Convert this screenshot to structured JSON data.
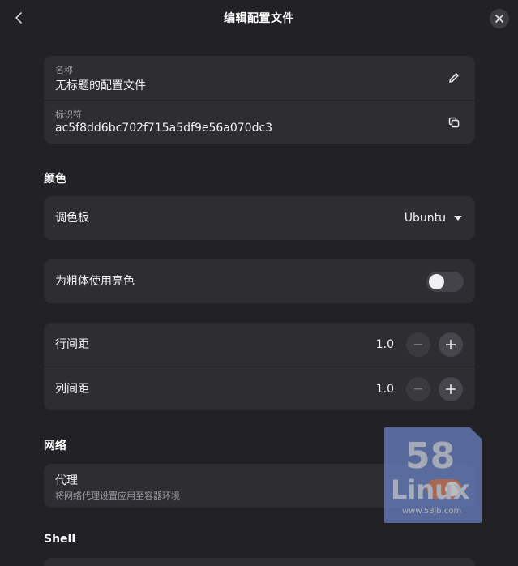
{
  "header": {
    "title": "编辑配置文件"
  },
  "profile": {
    "name_label": "名称",
    "name_value": "无标题的配置文件",
    "id_label": "标识符",
    "id_value": "ac5f8dd6bc702f715a5df9e56a070dc3"
  },
  "colors": {
    "section_title": "颜色",
    "palette_label": "调色板",
    "palette_value": "Ubuntu",
    "bold_bright_label": "为粗体使用亮色",
    "bold_bright_enabled": false,
    "line_spacing_label": "行间距",
    "line_spacing_value": "1.0",
    "column_spacing_label": "列间距",
    "column_spacing_value": "1.0"
  },
  "network": {
    "section_title": "网络",
    "proxy_label": "代理",
    "proxy_subtitle": "将网络代理设置应用至容器环境",
    "proxy_enabled": true
  },
  "shell": {
    "section_title": "Shell"
  },
  "watermark": {
    "number": "58",
    "word": "Linux",
    "url": "www.58jb.com"
  },
  "colors_theme": {
    "background": "#222226",
    "card": "#2e2e32",
    "accent_toggle": "#d9805d"
  },
  "icons": [
    "back-icon",
    "close-icon",
    "pencil-icon",
    "copy-icon",
    "dropdown-arrow-icon",
    "minus-icon",
    "plus-icon"
  ]
}
